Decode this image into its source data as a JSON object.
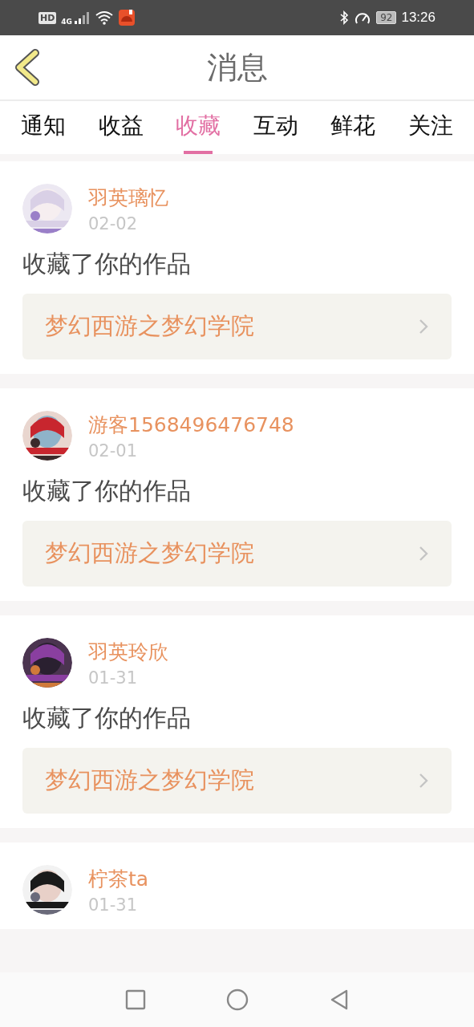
{
  "status_bar": {
    "hd": "HD",
    "network": "4G",
    "battery": "92",
    "time": "13:26"
  },
  "header": {
    "title": "消息"
  },
  "tabs": [
    {
      "label": "通知",
      "selected": false
    },
    {
      "label": "收益",
      "selected": false
    },
    {
      "label": "收藏",
      "selected": true
    },
    {
      "label": "互动",
      "selected": false
    },
    {
      "label": "鲜花",
      "selected": false
    },
    {
      "label": "关注",
      "selected": false
    }
  ],
  "messages": [
    {
      "user": "羽英璃忆",
      "date": "02-02",
      "action": "收藏了你的作品",
      "work": "梦幻西游之梦幻学院"
    },
    {
      "user": "游客1568496476748",
      "date": "02-01",
      "action": "收藏了你的作品",
      "work": "梦幻西游之梦幻学院"
    },
    {
      "user": "羽英玲欣",
      "date": "01-31",
      "action": "收藏了你的作品",
      "work": "梦幻西游之梦幻学院"
    },
    {
      "user": "柠茶ta",
      "date": "01-31"
    }
  ]
}
